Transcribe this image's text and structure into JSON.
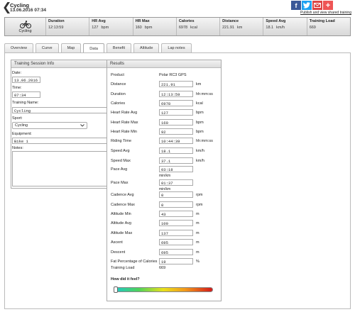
{
  "header": {
    "back_glyph": "❮",
    "title": "Cycling",
    "subtitle": "13.06.2016 07:34",
    "share_link": "Publish and view shared training",
    "share_icons": [
      "facebook-icon",
      "twitter-icon",
      "mail-icon",
      "plus-icon"
    ]
  },
  "summary": {
    "sport_label": "Cycling",
    "stats": [
      {
        "label": "Duration",
        "value": "12:13:59",
        "unit": ""
      },
      {
        "label": "HR Avg",
        "value": "127",
        "unit": "bpm"
      },
      {
        "label": "HR Max",
        "value": "160",
        "unit": "bpm"
      },
      {
        "label": "Calories",
        "value": "6978",
        "unit": "kcal"
      },
      {
        "label": "Distance",
        "value": "221.91",
        "unit": "km"
      },
      {
        "label": "Speed Avg",
        "value": "18.1",
        "unit": "km/h"
      },
      {
        "label": "Training Load",
        "value": "669",
        "unit": ""
      }
    ]
  },
  "tabs": [
    {
      "label": "Overview",
      "active": false
    },
    {
      "label": "Curve",
      "active": false
    },
    {
      "label": "Map",
      "active": false
    },
    {
      "label": "Data",
      "active": true
    },
    {
      "label": "Benefit",
      "active": false
    },
    {
      "label": "Altitude",
      "active": false
    },
    {
      "label": "Lap notes",
      "active": false
    }
  ],
  "session_info": {
    "heading": "Training Session Info",
    "date_label": "Date:",
    "date_value": "13.06.2016",
    "time_label": "Time:",
    "time_value": "07:34",
    "name_label": "Training Name:",
    "name_value": "Cycling",
    "sport_label": "Sport:",
    "sport_value": "Cycling",
    "equipment_label": "Equipment:",
    "equipment_value": "Bike 1",
    "notes_label": "Notes:",
    "notes_value": ""
  },
  "results": {
    "heading": "Results",
    "product_label": "Product",
    "product_value": "Polar RC3 GPS",
    "rows": [
      {
        "label": "Distance",
        "value": "221.91",
        "unit": "km"
      },
      {
        "label": "Duration",
        "value": "12:13:59",
        "unit": "hh:mm:ss"
      },
      {
        "label": "Calories",
        "value": "6978",
        "unit": "kcal"
      },
      {
        "label": "Heart Rate Avg",
        "value": "127",
        "unit": "bpm"
      },
      {
        "label": "Heart Rate Max",
        "value": "160",
        "unit": "bpm"
      },
      {
        "label": "Heart Rate Min",
        "value": "92",
        "unit": "bpm"
      },
      {
        "label": "Riding Time",
        "value": "10:44:39",
        "unit": "hh:mm:ss"
      },
      {
        "label": "Speed Avg",
        "value": "18.1",
        "unit": "km/h"
      },
      {
        "label": "Speed Max",
        "value": "37.1",
        "unit": "km/h"
      },
      {
        "label": "Pace Avg",
        "value": "03:18",
        "unit": "min/km"
      },
      {
        "label": "Pace Max",
        "value": "01:37",
        "unit": "min/km"
      },
      {
        "label": "Cadence Avg",
        "value": "0",
        "unit": "rpm"
      },
      {
        "label": "Cadence Max",
        "value": "0",
        "unit": "rpm"
      },
      {
        "label": "Altitude Min",
        "value": "43",
        "unit": "m"
      },
      {
        "label": "Altitude Avg",
        "value": "100",
        "unit": "m"
      },
      {
        "label": "Altitude Max",
        "value": "137",
        "unit": "m"
      },
      {
        "label": "Ascent",
        "value": "695",
        "unit": "m"
      },
      {
        "label": "Descent",
        "value": "695",
        "unit": "m"
      },
      {
        "label": "Fat Percentage of Calories",
        "value": "19",
        "unit": "%"
      }
    ],
    "training_load_label": "Training Load",
    "training_load_value": "669",
    "feel_label": "How did it feel?",
    "feel_level": 0
  }
}
